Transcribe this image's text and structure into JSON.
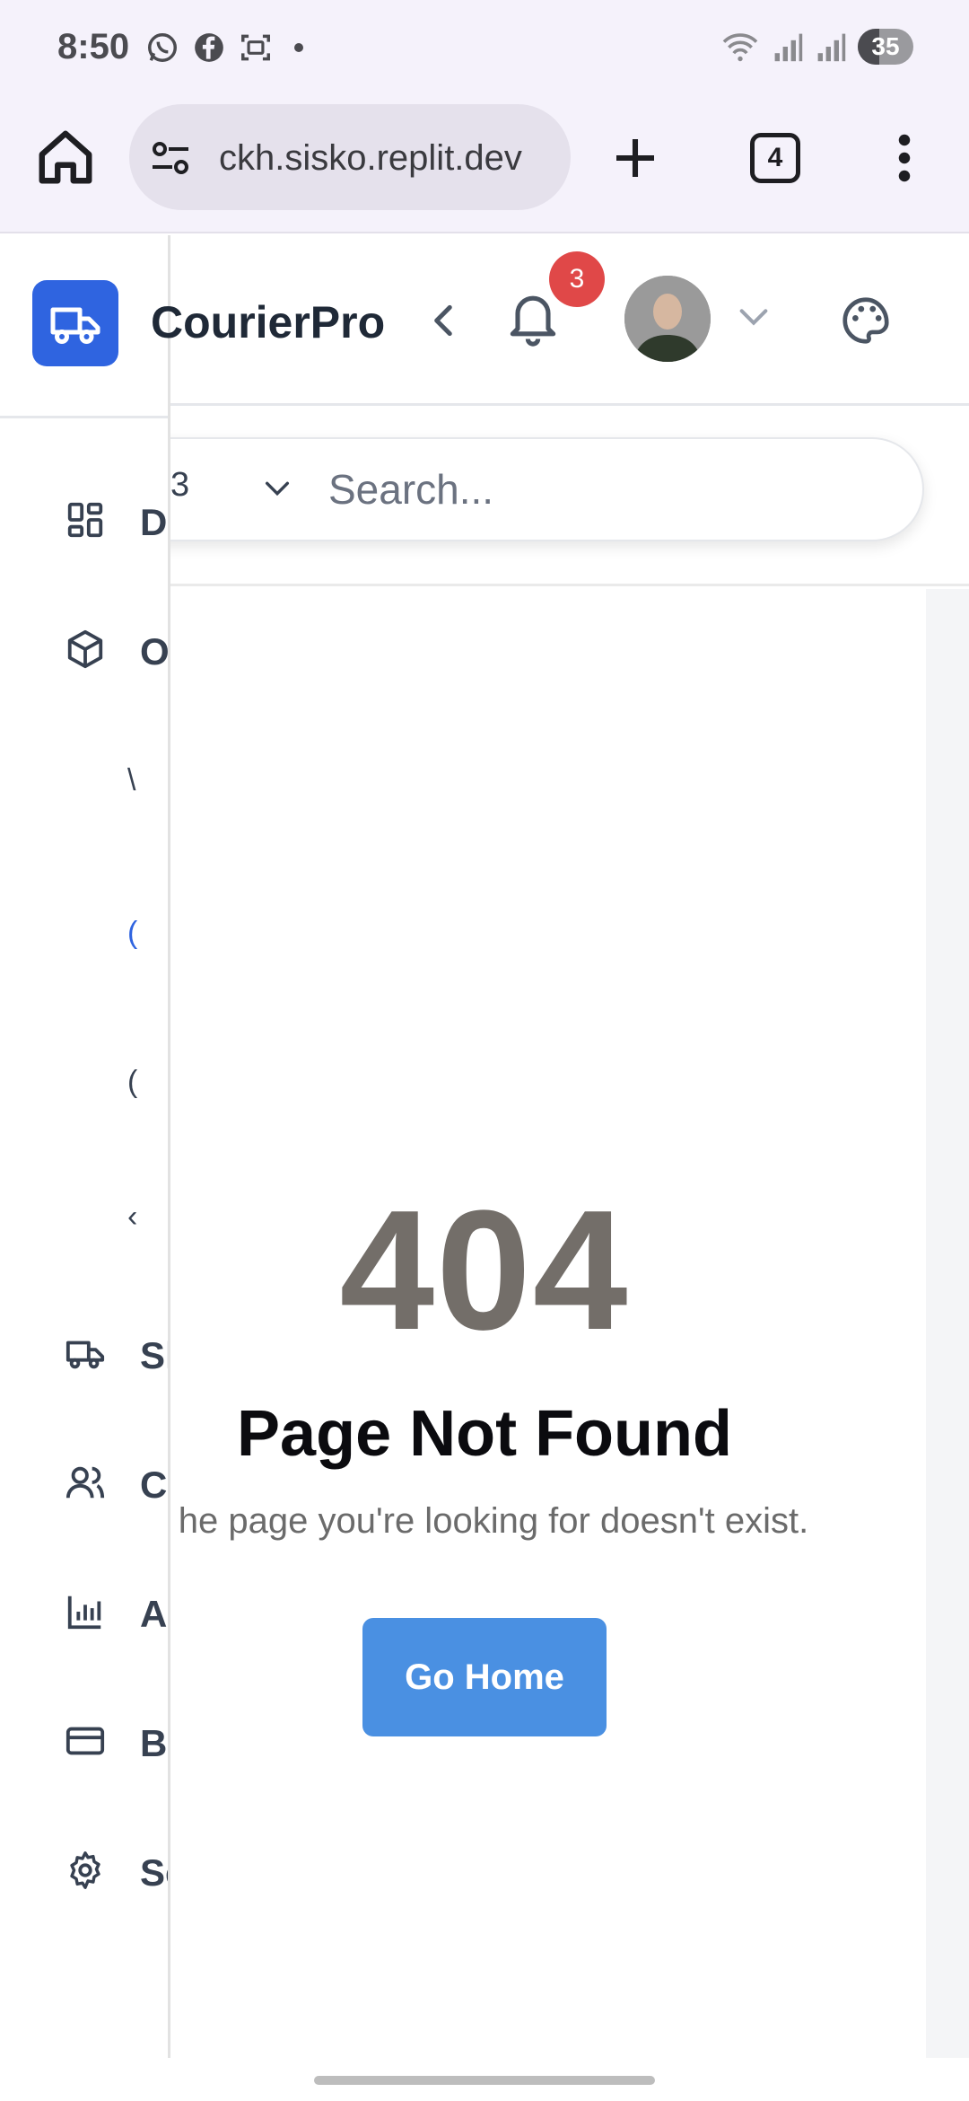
{
  "status_bar": {
    "time": "8:50",
    "battery": "35",
    "icons": [
      "whatsapp-icon",
      "facebook-icon",
      "screenshot-icon",
      "notification-dot",
      "wifi-icon",
      "signal-icon",
      "signal-icon",
      "battery-icon"
    ]
  },
  "browser": {
    "url": "ckh.sisko.replit.dev",
    "tab_count": "4"
  },
  "header": {
    "brand_name": "CourierPro",
    "notification_count": "3"
  },
  "search": {
    "select_value": "3",
    "placeholder": "Search..."
  },
  "sidebar": {
    "items": [
      {
        "label": "Da",
        "icon": "dashboard-icon"
      },
      {
        "label": "Or",
        "icon": "package-icon"
      },
      {
        "label": "Sh",
        "icon": "truck-icon"
      },
      {
        "label": "Cu",
        "icon": "users-icon"
      },
      {
        "label": "An",
        "icon": "chart-icon"
      },
      {
        "label": "Bi",
        "icon": "credit-card-icon"
      },
      {
        "label": "Se",
        "icon": "gear-icon"
      }
    ],
    "sub_items": [
      "\\",
      "(",
      "(",
      "‹"
    ]
  },
  "error": {
    "code": "404",
    "title": "Page Not Found",
    "description": "he page you're looking for doesn't exist.",
    "button": "Go Home"
  },
  "colors": {
    "brand_blue": "#2f64e0",
    "button_blue": "#4a90e2",
    "badge_red": "#e04848",
    "code_gray": "#736e69"
  }
}
